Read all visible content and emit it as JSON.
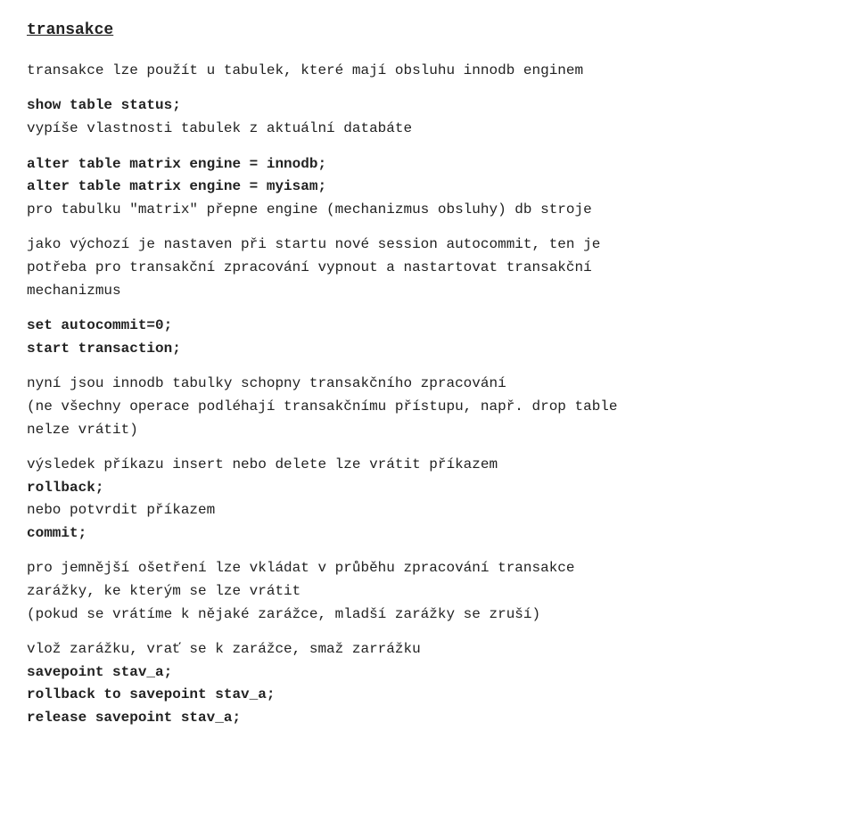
{
  "page": {
    "title": "transakce",
    "sections": [
      {
        "id": "intro",
        "lines": [
          {
            "text": "transakce lze použít u tabulek, které mají obsluhu innodb enginem",
            "bold": false
          }
        ]
      },
      {
        "id": "show-table",
        "lines": [
          {
            "text": "show table status;",
            "bold": true
          },
          {
            "text": "vypíše vlastnosti tabulek z aktuální databáte",
            "bold": false
          }
        ]
      },
      {
        "id": "alter-table",
        "lines": [
          {
            "text": "alter table matrix engine = innodb;",
            "bold": true
          },
          {
            "text": "alter table matrix engine = myisam;",
            "bold": true
          },
          {
            "text": "pro tabulku \"matrix\" přepne engine (mechanizmus obsluhy) db stroje",
            "bold": false
          }
        ]
      },
      {
        "id": "autocommit-desc",
        "lines": [
          {
            "text": "jako výchozí je nastaven při startu nové session autocommit, ten je",
            "bold": false
          },
          {
            "text": "potřeba pro transakční zpracování vypnout a nastartovat transakční",
            "bold": false
          },
          {
            "text": "mechanizmus",
            "bold": false
          }
        ]
      },
      {
        "id": "set-autocommit",
        "lines": [
          {
            "text": "set autocommit=0;",
            "bold": true
          },
          {
            "text": "start transaction;",
            "bold": true
          }
        ]
      },
      {
        "id": "innodb-desc",
        "lines": [
          {
            "text": "nyní jsou innodb tabulky schopny transakčního zpracování",
            "bold": false
          },
          {
            "text": "(ne všechny operace podléhají transakčnímu přístupu, např. drop table",
            "bold": false
          },
          {
            "text": "nelze vrátit)",
            "bold": false
          }
        ]
      },
      {
        "id": "rollback-desc",
        "lines": [
          {
            "text": "výsledek příkazu insert nebo delete lze vrátit příkazem",
            "bold": false
          },
          {
            "text": "rollback;",
            "bold": true
          },
          {
            "text": "nebo potvrdit příkazem",
            "bold": false
          },
          {
            "text": "commit;",
            "bold": true
          }
        ]
      },
      {
        "id": "savepoint-desc",
        "lines": [
          {
            "text": "pro jemnější ošetření lze vkládat v průběhu zpracování transakce",
            "bold": false
          },
          {
            "text": "zarážky, ke kterým se lze vrátit",
            "bold": false
          },
          {
            "text": "(pokud se vrátíme k nějaké zarážce, mladší zarážky se zruší)",
            "bold": false
          }
        ]
      },
      {
        "id": "savepoint-commands",
        "lines": [
          {
            "text": "vlož zarážku, vrať se k zarážce, smaž zarrážku",
            "bold": false
          },
          {
            "text": "savepoint stav_a;",
            "bold": true
          },
          {
            "text": "rollback to savepoint stav_a;",
            "bold": true
          },
          {
            "text": "release savepoint stav_a;",
            "bold": true
          }
        ]
      }
    ]
  }
}
